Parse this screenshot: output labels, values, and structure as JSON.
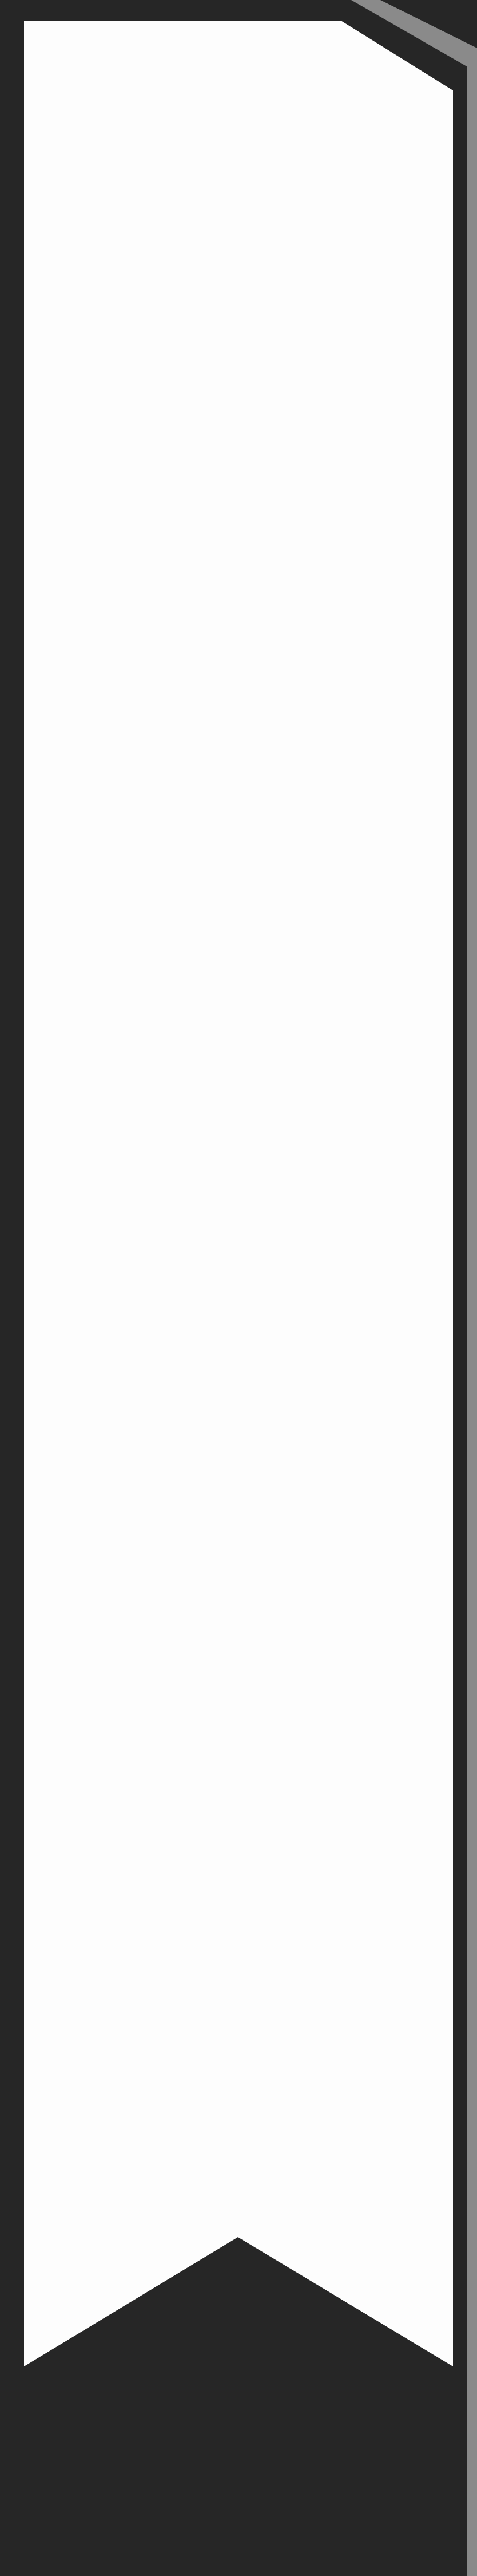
{
  "colors": {
    "background": "#262626",
    "ribbon_fill": "#fdfdfd",
    "edge_highlight": "#8a8a8a"
  },
  "shape": {
    "kind": "vertical-banner-ribbon",
    "top_right_corner": "folded",
    "bottom_edge": "swallowtail-notch"
  }
}
